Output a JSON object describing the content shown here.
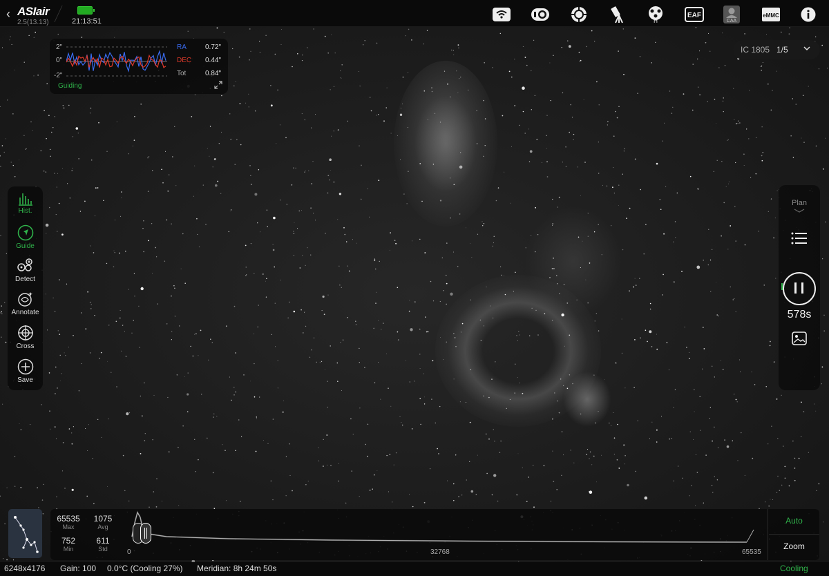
{
  "app": {
    "logo_text": "ASIair",
    "version": "2.5(13.13)",
    "time": "21:13:51"
  },
  "toolbar_icons": [
    "wifi-icon",
    "camera-icon",
    "mount-icon",
    "telescope-icon",
    "filter-wheel-icon",
    "eaf-icon",
    "caa-icon",
    "emmc-icon",
    "info-icon"
  ],
  "toolbar_labels": {
    "eaf": "EAF",
    "caa": "CAA",
    "emmc": "eMMC",
    "filter": "H"
  },
  "guide_graph": {
    "y_top": "2\"",
    "y_mid": "0\"",
    "y_bottom": "-2\"",
    "ra_label": "RA",
    "ra_value": "0.72\"",
    "dec_label": "DEC",
    "dec_value": "0.44\"",
    "tot_label": "Tot",
    "tot_value": "0.84\"",
    "status": "Guiding",
    "ra_color": "#3a6cf0",
    "dec_color": "#e03a2a"
  },
  "target": {
    "name": "IC 1805",
    "index": "1/5"
  },
  "left_tools": [
    {
      "label": "Hist.",
      "icon": "histogram-icon",
      "active": true
    },
    {
      "label": "Guide",
      "icon": "guide-icon",
      "active": true
    },
    {
      "label": "Detect",
      "icon": "detect-icon",
      "active": false
    },
    {
      "label": "Annotate",
      "icon": "annotate-icon",
      "active": false
    },
    {
      "label": "Cross",
      "icon": "crosshair-icon",
      "active": false
    },
    {
      "label": "Save",
      "icon": "save-icon",
      "active": false
    }
  ],
  "right_panel": {
    "plan_label": "Plan",
    "countdown": "578s"
  },
  "histogram": {
    "max": "65535",
    "max_label": "Max",
    "avg": "1075",
    "avg_label": "Avg",
    "min": "752",
    "min_label": "Min",
    "std": "611",
    "std_label": "Std",
    "axis_min": "0",
    "axis_mid": "32768",
    "axis_max": "65535",
    "auto_label": "Auto",
    "zoom_label": "Zoom"
  },
  "status": {
    "resolution": "6248x4176",
    "gain": "Gain: 100",
    "temperature": "0.0°C (Cooling 27%)",
    "meridian": "Meridian: 8h 24m 50s",
    "cooling": "Cooling"
  },
  "colors": {
    "accent_green": "#2fb24a",
    "background": "#1e1e1e"
  }
}
